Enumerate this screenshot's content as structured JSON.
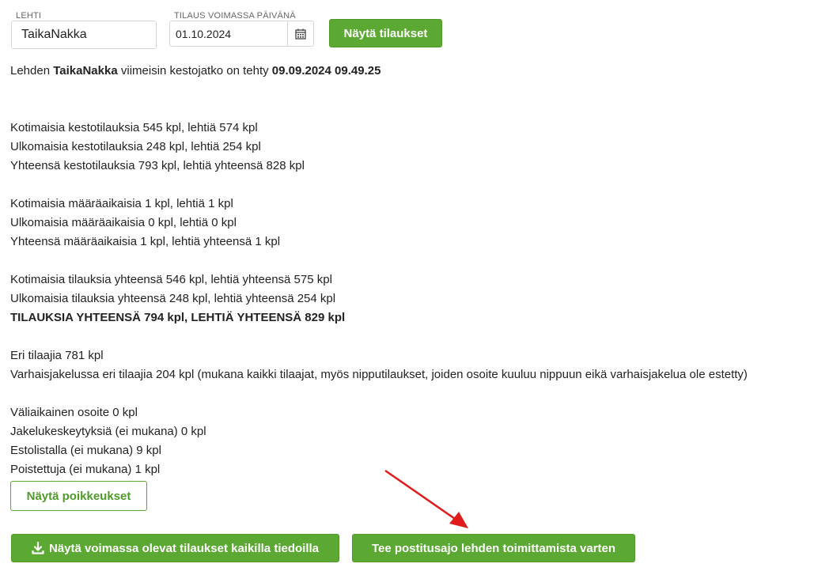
{
  "filters": {
    "magazine_label": "LEHTI",
    "magazine_value": "TaikaNakka",
    "date_label": "TILAUS VOIMASSA PÄIVÄNÄ",
    "date_value": "01.10.2024",
    "show_button": "Näytä tilaukset"
  },
  "last_renewal": {
    "prefix": "Lehden ",
    "magazine": "TaikaNakka",
    "middle": " viimeisin kestojatko on tehty ",
    "datetime": "09.09.2024 09.49.25"
  },
  "stats": {
    "continuous": [
      "Kotimaisia kestotilauksia 545 kpl, lehtiä 574 kpl",
      "Ulkomaisia kestotilauksia 248 kpl, lehtiä 254 kpl",
      "Yhteensä kestotilauksia 793 kpl, lehtiä yhteensä 828 kpl"
    ],
    "fixed_term": [
      "Kotimaisia määräaikaisia 1 kpl, lehtiä 1 kpl",
      "Ulkomaisia määräaikaisia 0 kpl, lehtiä 0 kpl",
      "Yhteensä määräaikaisia 1 kpl, lehtiä yhteensä 1 kpl"
    ],
    "totals": [
      "Kotimaisia tilauksia yhteensä 546 kpl, lehtiä yhteensä 575 kpl",
      "Ulkomaisia tilauksia yhteensä 248 kpl, lehtiä yhteensä 254 kpl"
    ],
    "grand_total": "TILAUKSIA YHTEENSÄ 794 kpl, LEHTIÄ YHTEENSÄ 829 kpl",
    "subscribers": [
      "Eri tilaajia 781 kpl",
      "Varhaisjakelussa eri tilaajia 204 kpl (mukana kaikki tilaajat, myös nipputilaukset, joiden osoite kuuluu nippuun eikä varhaisjakelua ole estetty)"
    ],
    "exceptions": [
      "Väliaikainen osoite 0 kpl",
      "Jakelukeskeytyksiä (ei mukana) 0 kpl",
      "Estolistalla (ei mukana) 9 kpl",
      "Poistettuja (ei mukana) 1 kpl"
    ]
  },
  "buttons": {
    "show_exceptions": "Näytä poikkeukset",
    "download_all": "Näytä voimassa olevat tilaukset kaikilla tiedoilla",
    "create_run": "Tee postitusajo lehden toimittamista varten"
  },
  "colors": {
    "accent_green": "#5ba832",
    "annotation_arrow": "#e01b1b"
  },
  "icons": {
    "calendar": "calendar-icon",
    "download": "download-icon"
  }
}
